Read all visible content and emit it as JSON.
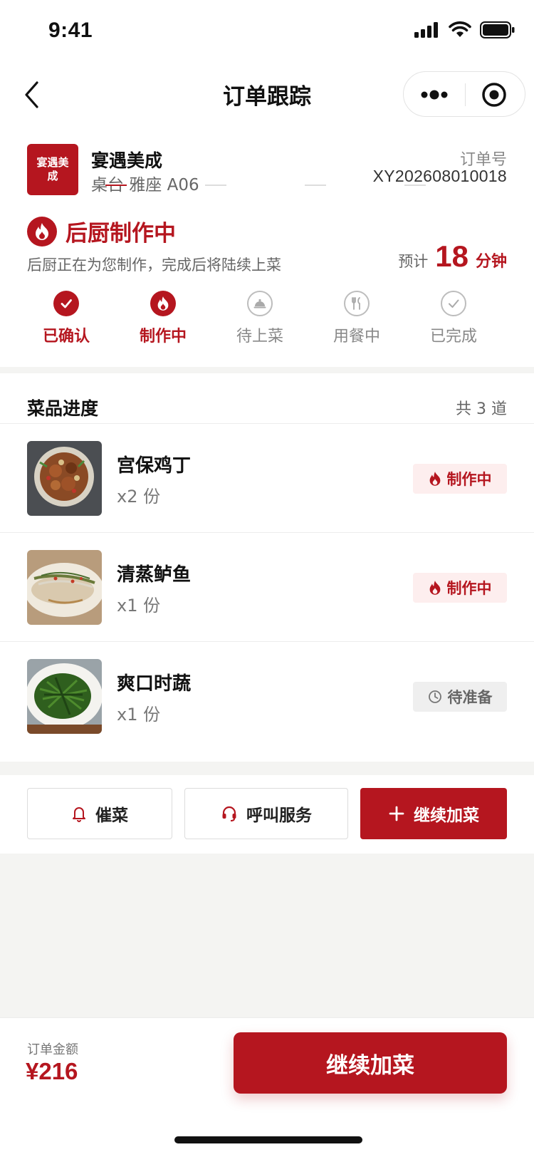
{
  "status_bar": {
    "time": "9:41"
  },
  "nav": {
    "title": "订单跟踪",
    "back_icon": "chevron-left-icon",
    "more_icon": "more-dots-icon",
    "close_icon": "target-circle-icon"
  },
  "shop": {
    "logo_text": "宴遇美成",
    "name": "宴遇美成",
    "table": "桌台 雅座 A06",
    "order_label": "订单号",
    "order_no": "XY202608010018"
  },
  "status": {
    "icon": "flame-icon",
    "title": "后厨制作中",
    "desc": "后厨正在为您制作，完成后将陆续上菜",
    "eta_label": "预计",
    "eta_value": "18",
    "eta_unit": "分钟"
  },
  "steps": [
    {
      "label": "已确认",
      "state": "done",
      "icon": "check-icon"
    },
    {
      "label": "制作中",
      "state": "current",
      "icon": "flame-icon"
    },
    {
      "label": "待上菜",
      "state": "pending",
      "icon": "cloche-icon"
    },
    {
      "label": "用餐中",
      "state": "pending",
      "icon": "utensils-icon"
    },
    {
      "label": "已完成",
      "state": "pending",
      "icon": "check-icon"
    }
  ],
  "dishes": {
    "title": "菜品进度",
    "count": "共 3 道",
    "items": [
      {
        "name": "宫保鸡丁",
        "qty": "x2 份",
        "status": "制作中",
        "status_type": "cooking",
        "status_icon": "flame-icon"
      },
      {
        "name": "清蒸鲈鱼",
        "qty": "x1 份",
        "status": "制作中",
        "status_type": "cooking",
        "status_icon": "flame-icon"
      },
      {
        "name": "爽口时蔬",
        "qty": "x1 份",
        "status": "待准备",
        "status_type": "waiting",
        "status_icon": "clock-icon"
      }
    ]
  },
  "actions": {
    "urge": "催菜",
    "call": "呼叫服务",
    "add": "继续加菜"
  },
  "bottom": {
    "total_label": "订单金额",
    "total_value": "¥216",
    "cta": "继续加菜"
  },
  "colors": {
    "brand": "#b5161f",
    "muted": "#888888",
    "badge_cooking_bg": "#fdeeee",
    "badge_waiting_bg": "#efefef"
  }
}
